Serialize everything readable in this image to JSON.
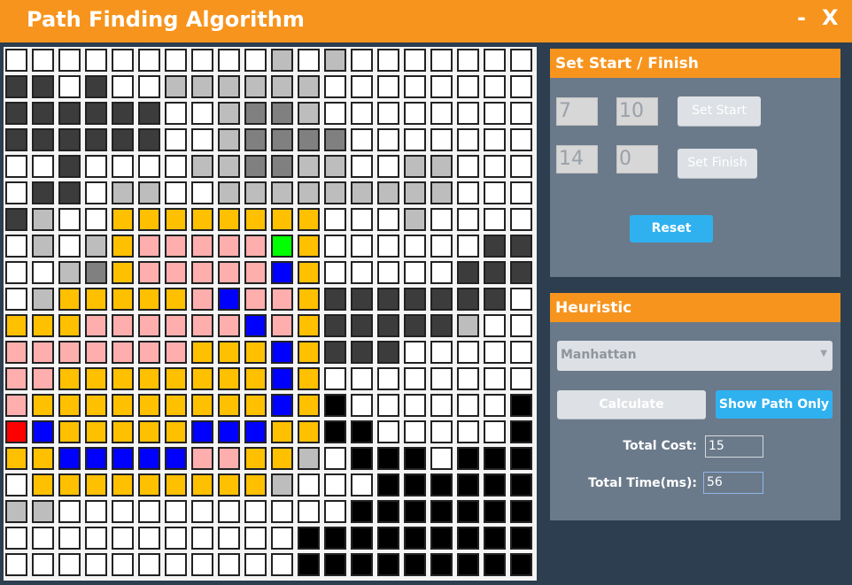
{
  "window": {
    "title": "Path Finding Algorithm",
    "minimize_label": "-",
    "close_label": "X"
  },
  "grid": {
    "rows": 20,
    "cols": 20,
    "legend": {
      "0": "#ffffff",
      "1": "#3c3c3c",
      "2": "#bdbdbd",
      "3": "#808080",
      "4": "#ffc000",
      "5": "#ffaeae",
      "6": "#0000ff",
      "7": "#00ff00",
      "8": "#ff0000",
      "9": "#000000"
    },
    "cells": [
      "00000000002020000000",
      "11010022222200000000",
      "11111100233200000000",
      "11111100233330000000",
      "00100002233220022000",
      "01102200222222222000",
      "12004444444400020000",
      "02024555557400000011",
      "00234555556400000111",
      "02444445655411111110",
      "44455555565411111200",
      "55555554446411100000",
      "55444444446400000000",
      "54444444446490000009",
      "86444446664499000009",
      "44666665544209990999",
      "04444444442000999999",
      "22000000000009999999",
      "00000000000999999999",
      "00000000000999999999"
    ]
  },
  "start_finish": {
    "header": "Set Start / Finish",
    "start_row": "7",
    "start_col": "10",
    "set_start_label": "Set Start",
    "finish_row": "14",
    "finish_col": "0",
    "set_finish_label": "Set Finish",
    "reset_label": "Reset"
  },
  "heuristic": {
    "header": "Heuristic",
    "selected": "Manhattan",
    "calculate_label": "Calculate",
    "show_path_label": "Show Path Only",
    "total_cost_label": "Total Cost:",
    "total_cost_value": "15",
    "total_time_label": "Total Time(ms):",
    "total_time_value": "56"
  },
  "colors": {
    "accent": "#f7941d",
    "background": "#2c3e50",
    "panel": "#6b7a8a",
    "primary_button": "#2fb1f0"
  }
}
